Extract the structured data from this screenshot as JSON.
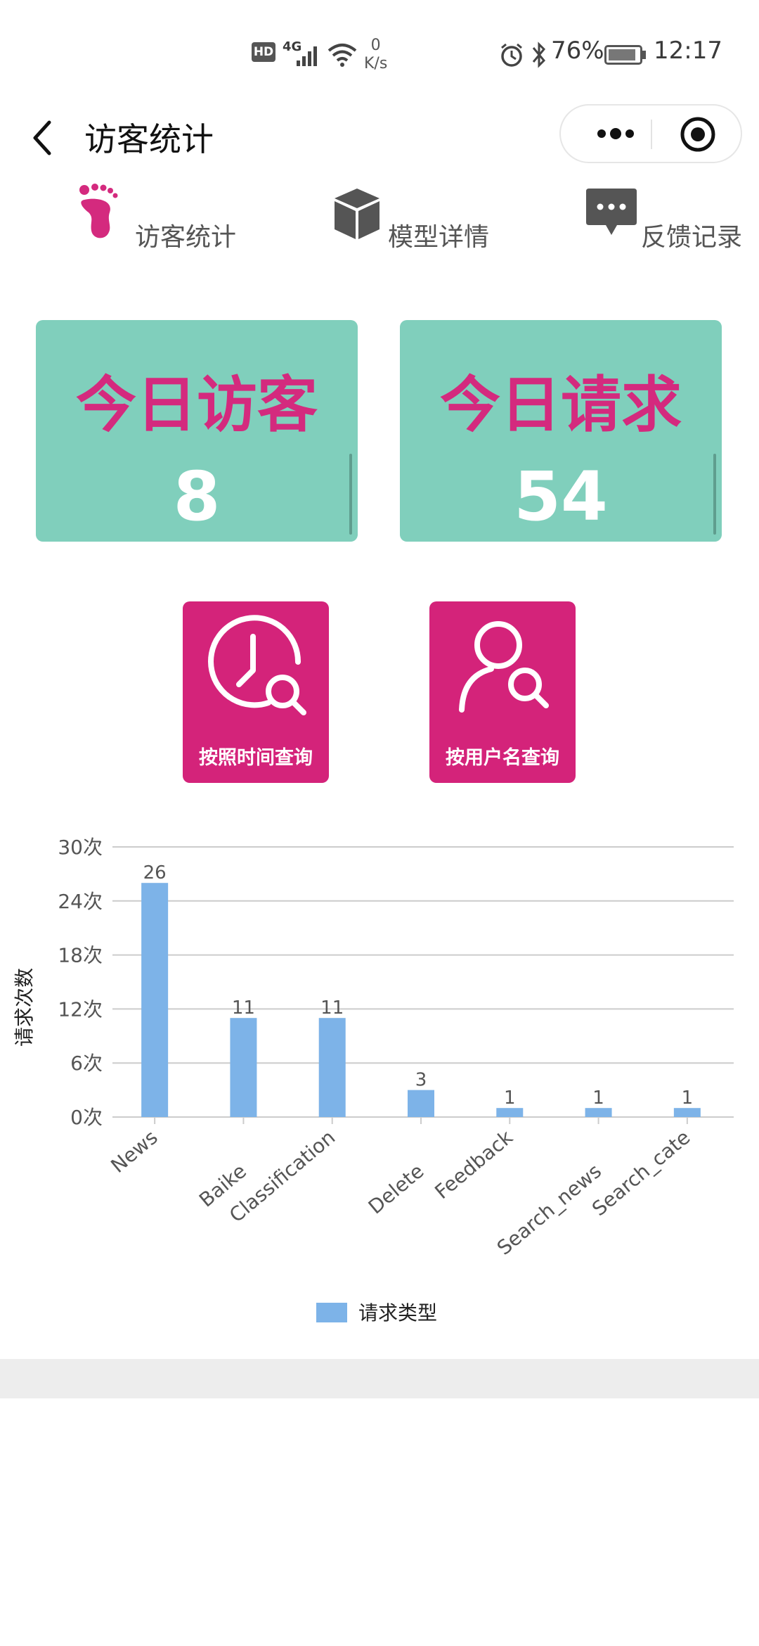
{
  "status_bar": {
    "hd": "HD",
    "network": "4G",
    "speed_value": "0",
    "speed_unit": "K/s",
    "battery": "76%",
    "time": "12:17"
  },
  "nav": {
    "title": "访客统计"
  },
  "tabs": [
    {
      "label": "访客统计",
      "icon": "footprint-icon",
      "color": "#d42a7e"
    },
    {
      "label": "模型详情",
      "icon": "cube-icon",
      "color": "#555555"
    },
    {
      "label": "反馈记录",
      "icon": "chat-bubble-icon",
      "color": "#555555"
    }
  ],
  "cards": [
    {
      "title": "今日访客",
      "value": "8"
    },
    {
      "title": "今日请求",
      "value": "54"
    }
  ],
  "query_buttons": [
    {
      "label": "按照时间查询",
      "icon": "clock-search-icon"
    },
    {
      "label": "按用户名查询",
      "icon": "user-search-icon"
    }
  ],
  "colors": {
    "accent": "#d42a7e",
    "card_bg": "#80cfbc",
    "bar": "#7db3e8"
  },
  "chart_data": {
    "type": "bar",
    "categories": [
      "News",
      "Baike",
      "Classification",
      "Delete",
      "Feedback",
      "Search_news",
      "Search_cate"
    ],
    "series": [
      {
        "name": "请求类型",
        "values": [
          26,
          11,
          11,
          3,
          1,
          1,
          1
        ]
      }
    ],
    "ylabel": "请求次数",
    "ylim": [
      0,
      30
    ],
    "yticks": [
      "0次",
      "6次",
      "12次",
      "18次",
      "24次",
      "30次"
    ],
    "grid": true,
    "legend": "bottom-center"
  }
}
